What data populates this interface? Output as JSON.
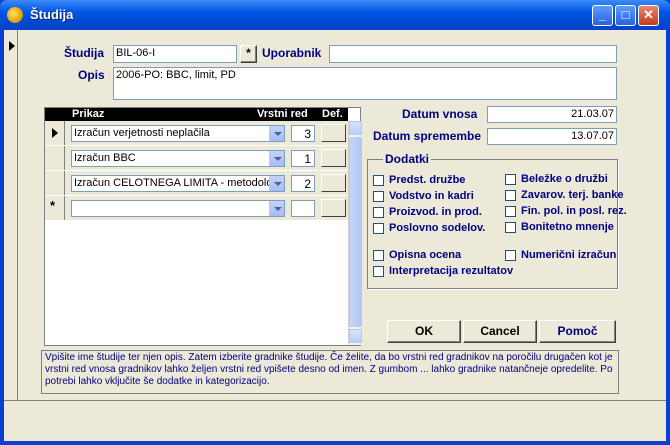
{
  "window": {
    "title": "Študija",
    "controls": {
      "minimize": "_",
      "maximize": "□",
      "close": "✕"
    }
  },
  "form": {
    "studija_label": "Študija",
    "studija_value": "BIL-06-I",
    "studija_button": "*",
    "uporabnik_label": "Uporabnik",
    "uporabnik_value": "",
    "opis_label": "Opis",
    "opis_value": "2006-PO: BBC, limit, PD"
  },
  "subform": {
    "headers": {
      "prikaz": "Prikaz",
      "vrstni_red": "Vrstni red",
      "def": "Def."
    },
    "rows": [
      {
        "prikaz": "Izračun verjetnosti neplačila",
        "vrstni_red": "3",
        "current": true
      },
      {
        "prikaz": "Izračun BBC",
        "vrstni_red": "1",
        "current": false
      },
      {
        "prikaz": "Izračun CELOTNEGA LIMITA - metodologija",
        "vrstni_red": "2",
        "current": false
      },
      {
        "prikaz": "",
        "vrstni_red": "",
        "new": true
      }
    ]
  },
  "dates": {
    "vnosa_label": "Datum vnosa",
    "vnosa_value": "21.03.07",
    "spremembe_label": "Datum spremembe",
    "spremembe_value": "13.07.07"
  },
  "dodatki": {
    "title": "Dodatki",
    "left": [
      "Predst. družbe",
      "Vodstvo in kadri",
      "Proizvod. in prod.",
      "Poslovno sodelov."
    ],
    "right": [
      "Beležke o družbi",
      "Zavarov. terj. banke",
      "Fin. pol. in posl. rez.",
      "Bonitetno mnenje"
    ],
    "bottom_left": [
      "Opisna ocena",
      "Interpretacija rezultatov"
    ],
    "bottom_right": [
      "Numerični izračun"
    ]
  },
  "buttons": {
    "ok": "OK",
    "cancel": "Cancel",
    "help": "Pomoč"
  },
  "info_text": "Vpišite ime študije ter njen opis. Zatem izberite gradnike študije. Če želite, da bo vrstni red gradnikov na poročilu drugačen kot je vrstni red vnosa gradnikov lahko željen vrstni red vpišete desno od imen. Z gumbom ... lahko gradnike natančneje opredelite. Po potrebi lahko vključite še dodatke in kategorizacijo.",
  "colors": {
    "label": "#000080",
    "titlebar": "#0055E5",
    "background": "#ECE9D8"
  },
  "icons": {
    "app": "access-form-icon",
    "current_record": "record-pointer-icon",
    "new_record": "new-record-icon"
  }
}
